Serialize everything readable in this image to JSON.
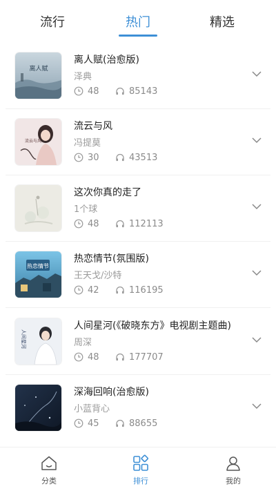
{
  "tabs": [
    {
      "label": "流行",
      "active": false
    },
    {
      "label": "热门",
      "active": true
    },
    {
      "label": "精选",
      "active": false
    }
  ],
  "songs": [
    {
      "title": "离人赋(治愈版)",
      "artist": "泽典",
      "duration": "48",
      "plays": "85143",
      "cover_text": "离人赋"
    },
    {
      "title": "流云与风",
      "artist": "冯提莫",
      "duration": "30",
      "plays": "43513",
      "cover_text": "流云与风"
    },
    {
      "title": "这次你真的走了",
      "artist": "1个球",
      "duration": "48",
      "plays": "112113",
      "cover_text": ""
    },
    {
      "title": "热恋情节(氛围版)",
      "artist": "王天戈/沙特",
      "duration": "42",
      "plays": "116195",
      "cover_text": "热恋情节"
    },
    {
      "title": "人间星河(《破晓东方》电视剧主题曲)",
      "artist": "周深",
      "duration": "48",
      "plays": "177707",
      "cover_text": "人间星河"
    },
    {
      "title": "深海回响(治愈版)",
      "artist": "小蓝背心",
      "duration": "45",
      "plays": "88655",
      "cover_text": ""
    }
  ],
  "bottom_nav": [
    {
      "label": "分类",
      "icon": "home-icon",
      "active": false
    },
    {
      "label": "排行",
      "icon": "grid-icon",
      "active": true
    },
    {
      "label": "我的",
      "icon": "user-icon",
      "active": false
    }
  ],
  "colors": {
    "accent": "#3d8fd6",
    "text": "#222222",
    "muted": "#9a9a9a"
  }
}
